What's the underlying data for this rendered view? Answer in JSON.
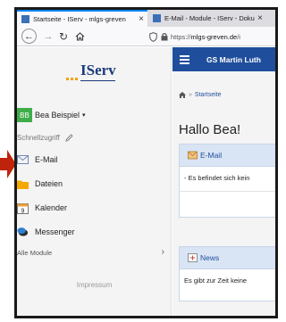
{
  "browser": {
    "tabs": [
      {
        "title": "Startseite - IServ - mlgs-greven",
        "active": true
      },
      {
        "title": "E-Mail - Module - IServ - Doku",
        "active": false
      }
    ],
    "url": {
      "prefix": "https://",
      "host": "mlgs-greven.de",
      "suffix": "/i"
    }
  },
  "sidebar": {
    "logo": "IServ",
    "user": {
      "initials": "BB",
      "name": "Bea Beispiel"
    },
    "quick_access_label": "Schnellzugriff",
    "items": [
      {
        "label": "E-Mail",
        "icon": "envelope-icon"
      },
      {
        "label": "Dateien",
        "icon": "folder-icon"
      },
      {
        "label": "Kalender",
        "icon": "calendar-icon",
        "calendar_day": "9"
      },
      {
        "label": "Messenger",
        "icon": "messenger-icon"
      }
    ],
    "all_modules_label": "Alle Module",
    "impressum_label": "Impressum"
  },
  "main": {
    "school_name": "GS Martin Luth",
    "breadcrumb": "Startseite",
    "greeting": "Hallo Bea!",
    "email_panel": {
      "title": "E-Mail",
      "text": "- Es befindet sich kein"
    },
    "news_panel": {
      "title": "News",
      "text": "Es gibt zur Zeit keine"
    }
  },
  "colors": {
    "accent": "#1f4e9c",
    "user_badge": "#3fae49",
    "arrow": "#c0230b",
    "logo_dots": "#f0a400"
  }
}
